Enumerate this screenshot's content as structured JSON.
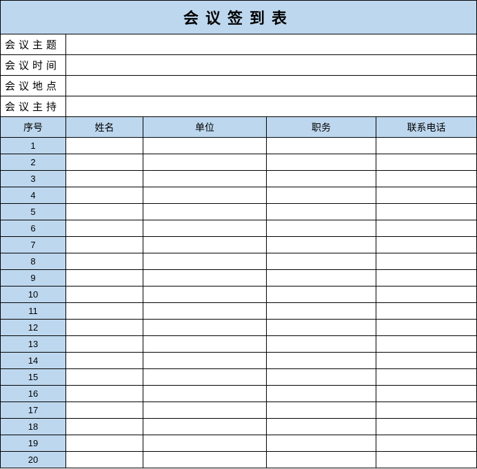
{
  "title": "会议签到表",
  "info_rows": [
    {
      "label": "会议主题",
      "value": ""
    },
    {
      "label": "会议时间",
      "value": ""
    },
    {
      "label": "会议地点",
      "value": ""
    },
    {
      "label": "会议主持",
      "value": ""
    }
  ],
  "columns": [
    "序号",
    "姓名",
    "单位",
    "职务",
    "联系电话"
  ],
  "rows": [
    "1",
    "2",
    "3",
    "4",
    "5",
    "6",
    "7",
    "8",
    "9",
    "10",
    "11",
    "12",
    "13",
    "14",
    "15",
    "16",
    "17",
    "18",
    "19",
    "20"
  ]
}
